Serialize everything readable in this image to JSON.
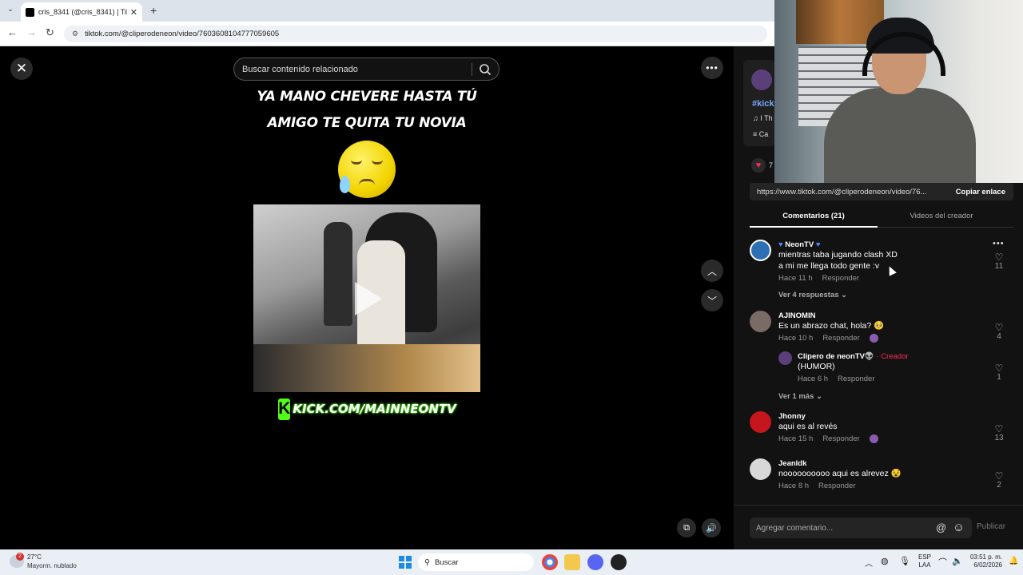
{
  "browser": {
    "tab_title": "cris_8341 (@cris_8341) | Tik",
    "tab_close": "✕",
    "new_tab": "+",
    "url": "tiktok.com/@cliperodeneon/video/7603608104777059605"
  },
  "overlay": {
    "close_label": "✕",
    "search_placeholder": "Buscar contenido relacionado",
    "more_label": "•••"
  },
  "video": {
    "caption_line1": "YA MANO CHEVERE HASTA TÚ",
    "caption_line2": "AMIGO TE QUITA TU NOVIA",
    "kick_letter": "K",
    "kick_text": "KICK.COM/MAINNEONTV"
  },
  "side": {
    "hashtag": "#kick",
    "music_snippet": "I Th",
    "cap_snippet": "Ca",
    "likes_snippet": "7"
  },
  "share": {
    "url": "https://www.tiktok.com/@cliperodeneon/video/76...",
    "copy_label": "Copiar enlace"
  },
  "tabs": {
    "comments": "Comentarios (21)",
    "creator_videos": "Videos del creador"
  },
  "comments": [
    {
      "name": "NeonTV",
      "text1": "mientras taba jugando clash XD",
      "text2": "a mi me llega todo gente :v",
      "time": "Hace 11 h",
      "reply": "Responder",
      "likes": "11",
      "more_replies": "Ver 4 respuestas",
      "avatar_color": "#2c6fb3"
    },
    {
      "name": "AJINOMIN",
      "text1": "Es un abrazo chat, hola? 🥺",
      "time": "Hace 10 h",
      "reply": "Responder",
      "likes": "4",
      "avatar_color": "#7a6b66"
    },
    {
      "name": "Jhonny",
      "text1": "aqui es al revés",
      "time": "Hace 15 h",
      "reply": "Responder",
      "likes": "13",
      "avatar_color": "#c4161c"
    },
    {
      "name": "Jeanldk",
      "text1": "noooooooooo aqui es alrevez 😵",
      "time": "Hace 8 h",
      "reply": "Responder",
      "likes": "2",
      "avatar_color": "#d8d8d8"
    }
  ],
  "reply": {
    "name": "Clipero de neonTV👽",
    "creator_tag": "· Creador",
    "text": "(HUMOR)",
    "time": "Hace 6 h",
    "reply": "Responder",
    "likes": "1",
    "more": "Ver 1 más"
  },
  "composer": {
    "placeholder": "Agregar comentario...",
    "at": "@",
    "emoji": "☺",
    "publish": "Publicar"
  },
  "taskbar": {
    "temp": "27°C",
    "weather": "Mayorm. nublado",
    "search": "Buscar",
    "lang1": "ESP",
    "lang2": "LAA",
    "time": "03:51 p. m.",
    "date": "6/02/2026",
    "badge": "2"
  }
}
